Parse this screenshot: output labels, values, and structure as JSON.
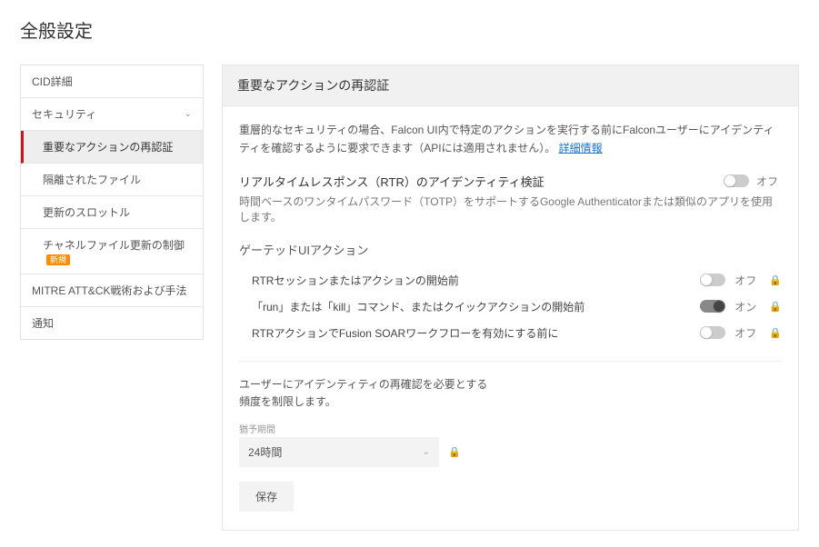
{
  "page_title": "全般設定",
  "sidebar": {
    "items": [
      {
        "label": "CID詳細"
      },
      {
        "label": "セキュリティ",
        "expandable": true
      },
      {
        "label": "重要なアクションの再認証",
        "sub": true,
        "active": true
      },
      {
        "label": "隔離されたファイル",
        "sub": true
      },
      {
        "label": "更新のスロットル",
        "sub": true
      },
      {
        "label": "チャネルファイル更新の制御",
        "sub": true,
        "badge": "新規"
      },
      {
        "label": "MITRE ATT&CK戦術および手法"
      },
      {
        "label": "通知"
      }
    ]
  },
  "panel": {
    "header": "重要なアクションの再認証",
    "desc_prefix": "重層的なセキュリティの場合、Falcon UI内で特定のアクションを実行する前にFalconユーザーにアイデンティティを確認するように要求できます（APIには適用されません）。",
    "desc_link": "詳細情報",
    "rtr": {
      "title": "リアルタイムレスポンス（RTR）のアイデンティティ検証",
      "subtitle": "時間ベースのワンタイムパスワード（TOTP）をサポートするGoogle Authenticatorまたは類似のアプリを使用します。",
      "state": "オフ",
      "on": false
    },
    "gated": {
      "title": "ゲーテッドUIアクション",
      "rows": [
        {
          "label": "RTRセッションまたはアクションの開始前",
          "state": "オフ",
          "on": false
        },
        {
          "label": "「run」または「kill」コマンド、またはクイックアクションの開始前",
          "state": "オン",
          "on": true
        },
        {
          "label": "RTRアクションでFusion SOARワークフローを有効にする前に",
          "state": "オフ",
          "on": false
        }
      ]
    },
    "freq": {
      "desc1": "ユーザーにアイデンティティの再確認を必要とする",
      "desc2": "頻度を制限します。",
      "field_label": "猶予期間",
      "value": "24時間"
    },
    "save": "保存"
  }
}
